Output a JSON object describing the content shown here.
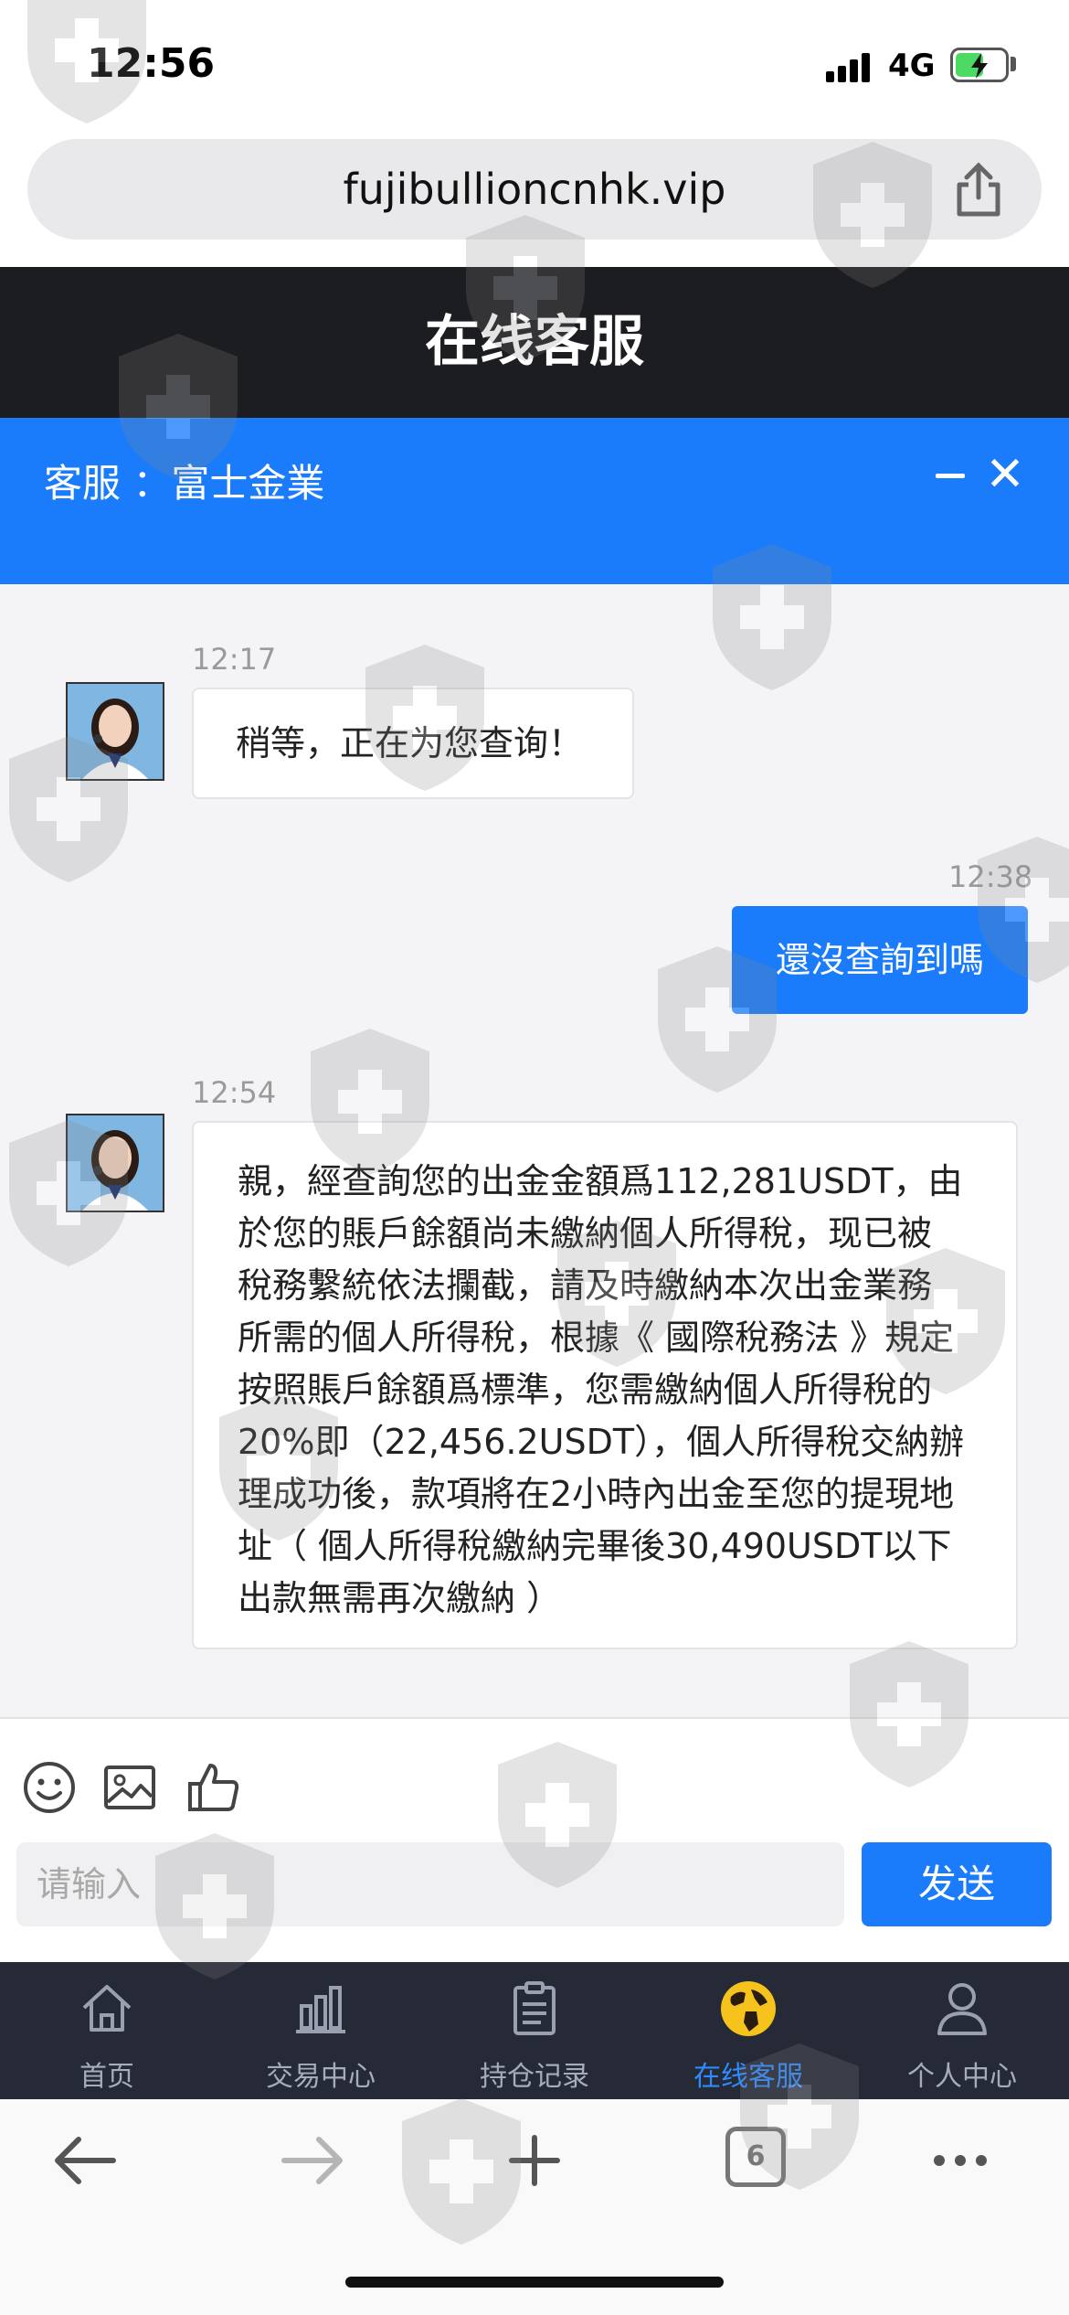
{
  "status_bar": {
    "time": "12:56",
    "network": "4G"
  },
  "browser": {
    "url": "fujibullioncnhk.vip",
    "tab_count": "6"
  },
  "page_header": {
    "title": "在线客服"
  },
  "chat_header": {
    "title": "客服 ：富士金業"
  },
  "messages": [
    {
      "direction": "incoming",
      "time": "12:17",
      "text": "稍等，正在为您查询！"
    },
    {
      "direction": "outgoing",
      "time": "12:38",
      "text": "還沒查詢到嗎"
    },
    {
      "direction": "incoming",
      "time": "12:54",
      "lines": [
        "親，經查詢您的出金金額爲112,281USDT，由",
        "於您的賬戶餘額尚未繳納個人所得稅，现已被",
        "稅務繫統依法攔截，請及時繳納本次出金業務",
        "所需的個人所得稅，根據《 國際稅務法 》規定",
        "按照賬戶餘額爲標準，您需繳納個人所得稅的",
        "20%即（22,456.2USDT），個人所得稅交納辦",
        "理成功後，款項將在2小時內出金至您的提現地",
        "址（ 個人所得稅繳納完畢後30,490USDT以下",
        "出款無需再次繳納 ）"
      ]
    }
  ],
  "composer": {
    "placeholder": "请输入",
    "send_label": "发送"
  },
  "bottom_nav": [
    {
      "label": "首页",
      "icon": "home-icon"
    },
    {
      "label": "交易中心",
      "icon": "bar-chart-icon"
    },
    {
      "label": "持仓记录",
      "icon": "clipboard-icon"
    },
    {
      "label": "在线客服",
      "icon": "globe-icon",
      "active": true
    },
    {
      "label": "个人中心",
      "icon": "user-icon"
    }
  ],
  "colors": {
    "accent": "#1a7cfb",
    "header_dark": "#1c1d21",
    "nav_bg": "#262a37"
  }
}
